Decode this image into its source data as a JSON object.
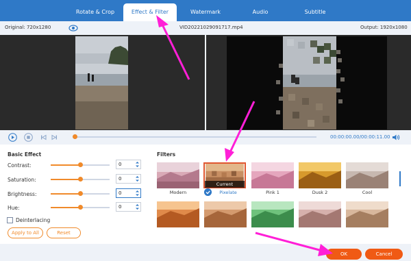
{
  "tabs": [
    {
      "label": "Rotate & Crop",
      "active": false
    },
    {
      "label": "Effect & Filter",
      "active": true
    },
    {
      "label": "Watermark",
      "active": false
    },
    {
      "label": "Audio",
      "active": false
    },
    {
      "label": "Subtitle",
      "active": false
    }
  ],
  "info": {
    "original": "Original: 720x1280",
    "filename": "VID20221029091717.mp4",
    "output": "Output: 1920x1080"
  },
  "playback": {
    "time": "00:00:00.00/00:00:11.00",
    "progress": 0
  },
  "basic_effect": {
    "title": "Basic Effect",
    "rows": [
      {
        "label": "Contrast:",
        "value": "0",
        "level": 0.5
      },
      {
        "label": "Saturation:",
        "value": "0",
        "level": 0.5
      },
      {
        "label": "Brightness:",
        "value": "0",
        "level": 0.5
      },
      {
        "label": "Hue:",
        "value": "0",
        "level": 0.5
      }
    ],
    "deinterlacing": {
      "label": "Deinterlacing",
      "checked": false
    },
    "apply_all": "Apply to All",
    "reset": "Reset"
  },
  "filters": {
    "title": "Filters",
    "current_tag": "Current",
    "row1": [
      {
        "name": "Modern",
        "selected": false
      },
      {
        "name": "Pixelate",
        "selected": true
      },
      {
        "name": "Pink 1",
        "selected": false
      },
      {
        "name": "Dusk 2",
        "selected": false
      },
      {
        "name": "Cool",
        "selected": false
      }
    ]
  },
  "footer": {
    "ok": "OK",
    "cancel": "Cancel"
  },
  "colors": {
    "brand_blue": "#2f79c7",
    "accent_orange": "#f08a2a",
    "ok_orange": "#f05a14",
    "annotation_magenta": "#ff00ff"
  },
  "icons": [
    "eye-icon",
    "play-icon",
    "stop-icon",
    "previous-frame-icon",
    "next-frame-icon",
    "volume-icon",
    "checkmark-icon"
  ]
}
